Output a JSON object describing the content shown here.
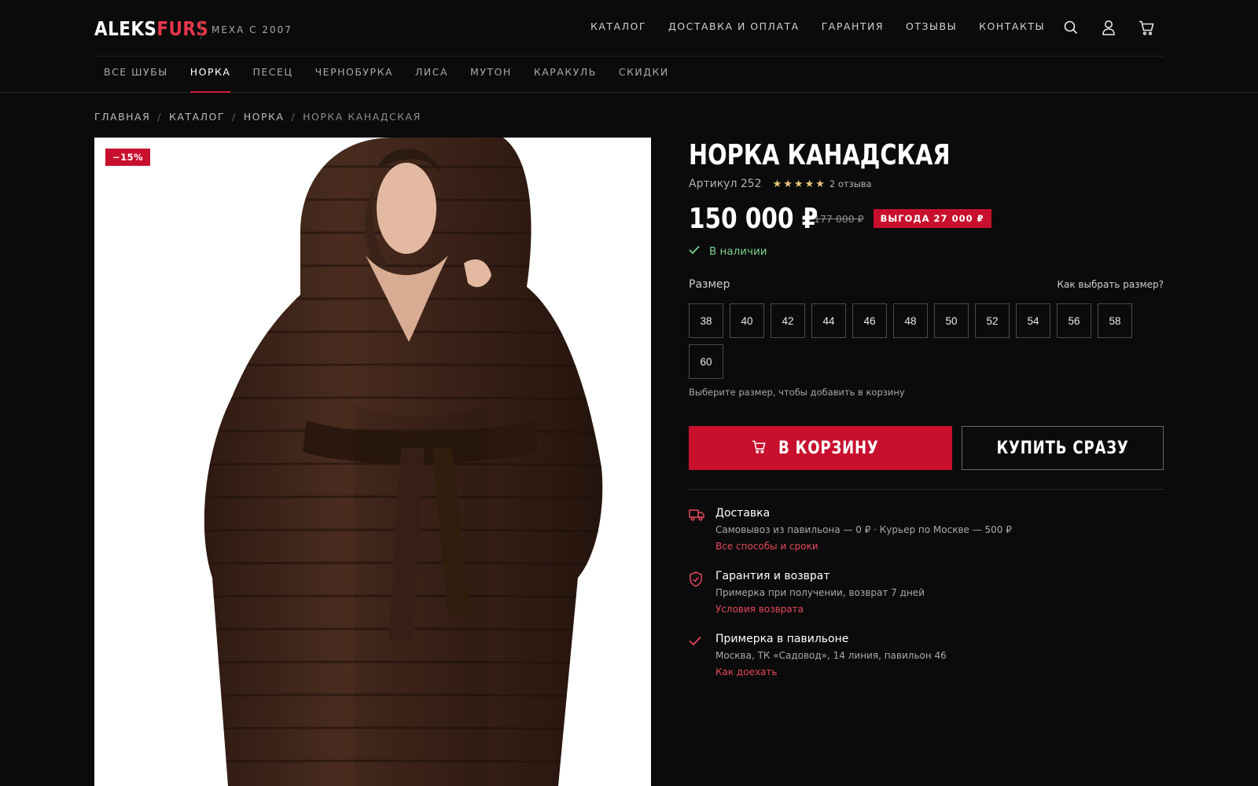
{
  "brand": {
    "logo_part1": "ALEKS",
    "logo_part2": "FURS",
    "tagline": "МЕХА С 2007"
  },
  "topnav": [
    "КАТАЛОГ",
    "ДОСТАВКА И ОПЛАТА",
    "ГАРАНТИЯ",
    "ОТЗЫВЫ",
    "КОНТАКТЫ"
  ],
  "header_icons": [
    "search-icon",
    "user-icon",
    "cart-icon"
  ],
  "catnav": [
    "ВСЕ ШУБЫ",
    "НОРКА",
    "ПЕСЕЦ",
    "ЧЕРНОБУРКА",
    "ЛИСА",
    "МУТОН",
    "КАРАКУЛЬ",
    "СКИДКИ"
  ],
  "catnav_active": "НОРКА",
  "breadcrumb": [
    "ГЛАВНАЯ",
    "КАТАЛОГ",
    "НОРКА",
    "НОРКА КАНАДСКАЯ"
  ],
  "breadcrumb_separator": "/",
  "product": {
    "discount_badge": "−15%",
    "title": "НОРКА КАНАДСКАЯ",
    "sku": "Артикул 252",
    "rating": 5,
    "star_glyph": "★",
    "reviews": "2 отзыва",
    "price": "150 000 ₽",
    "old_price": "177 000 ₽",
    "saving": "ВЫГОДА 27 000 ₽",
    "stock": "В наличии"
  },
  "size_block": {
    "label": "Размер",
    "guide": "Как выбрать размер?",
    "sizes": [
      "38",
      "40",
      "42",
      "44",
      "46",
      "48",
      "50",
      "52",
      "54",
      "56",
      "58",
      "60"
    ],
    "hint": "Выберите размер, чтобы добавить в корзину"
  },
  "buttons": {
    "cart": "В КОРЗИНУ",
    "buy": "КУПИТЬ СРАЗУ"
  },
  "features": [
    {
      "icon": "truck-icon",
      "title": "Доставка",
      "desc": "Самовывоз из павильона — 0 ₽ · Курьер по Москве — 500 ₽",
      "link": "Все способы и сроки"
    },
    {
      "icon": "shield-check-icon",
      "title": "Гарантия и возврат",
      "desc": "Примерка при получении, возврат 7 дней",
      "link": "Условия возврата"
    },
    {
      "icon": "check-icon",
      "title": "Примерка в павильоне",
      "desc": "Москва, ТК «Садовод», 14 линия, павильон 46",
      "link": "Как доехать"
    }
  ],
  "colors": {
    "accent": "#c8102e",
    "accent_link": "#e5485c",
    "stock_green": "#7fd18e",
    "star": "#e8c77c",
    "background": "#0b0b0b"
  }
}
